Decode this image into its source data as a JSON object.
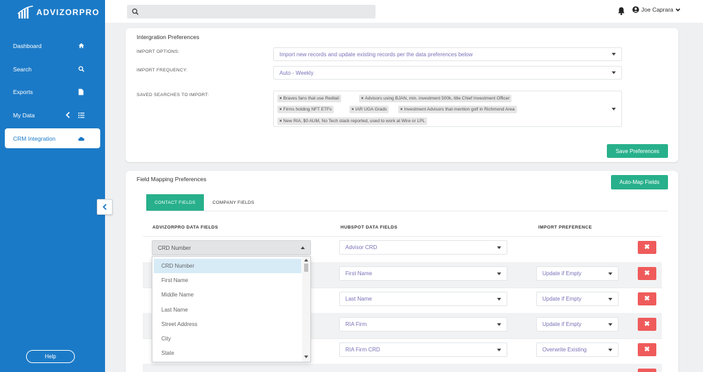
{
  "brand": {
    "name": "ADVIZORPRO"
  },
  "sidebar": {
    "items": [
      {
        "label": "Dashboard",
        "icon": "home-icon"
      },
      {
        "label": "Search",
        "icon": "search-icon"
      },
      {
        "label": "Exports",
        "icon": "file-icon"
      },
      {
        "label": "My Data",
        "icon": "list-icon"
      },
      {
        "label": "CRM Integration",
        "icon": "cloud-icon",
        "active": true
      }
    ],
    "help_label": "Help"
  },
  "header": {
    "search_placeholder": "",
    "user_name": "Joe Caprara"
  },
  "integration": {
    "title": "Intergration Preferences",
    "import_options_label": "IMPORT OPTIONS:",
    "import_options_value": "Import new records and update existing records per the data preferences below",
    "import_frequency_label": "IMPORT FREQUENCY:",
    "import_frequency_value": "Auto - Weekly",
    "saved_searches_label": "SAVED SEARCHES TO IMPORT:",
    "saved_searches": [
      "Braves fans that use Redtail",
      "Advisors using BJAN, min. investment 500k, title Chief Investment Officer",
      "Firms holding NFT ETFs",
      "IAR UGA Grads",
      "Investment Advisors that mention golf in Richmond Area",
      "New RIA, $0 AUM, No Tech stack reported, used to work at Wire or LPL"
    ],
    "save_button": "Save Preferences"
  },
  "mapping": {
    "title": "Field Mapping Preferences",
    "auto_map_button": "Auto-Map Fields",
    "tabs": [
      "CONTACT FIELDS",
      "COMPANY FIELDS"
    ],
    "columns": [
      "ADVIZORPRO DATA FIELDS",
      "HUBSPOT DATA FIELDS",
      "IMPORT PREFERENCE"
    ],
    "open_select_value": "CRD Number",
    "dropdown_options": [
      "CRD Number",
      "First Name",
      "Middle Name",
      "Last Name",
      "Street Address",
      "City",
      "State"
    ],
    "rows": [
      {
        "hubspot": "Advisor CRD",
        "preference": ""
      },
      {
        "hubspot": "First Name",
        "preference": "Update if Empty"
      },
      {
        "hubspot": "Last Name",
        "preference": "Update if Empty"
      },
      {
        "hubspot": "RIA Firm",
        "preference": "Update if Empty"
      },
      {
        "hubspot": "RIA Firm CRD",
        "preference": "Overwrite Existing"
      }
    ],
    "delete_symbol": "✖"
  },
  "colors": {
    "sidebar": "#1b7ac7",
    "accent_green": "#27b08b",
    "delete_red": "#ef5b5b"
  }
}
